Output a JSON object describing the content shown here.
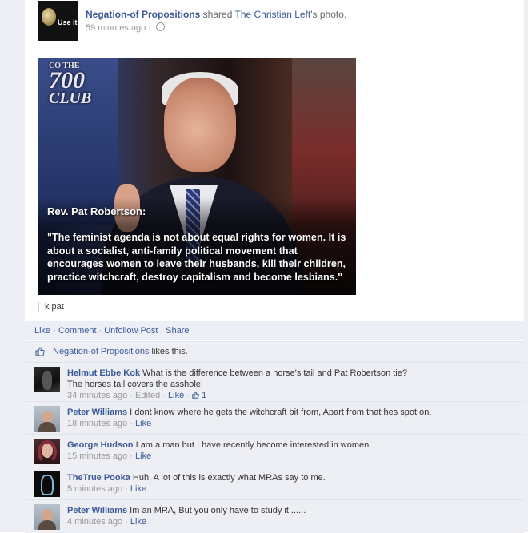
{
  "post": {
    "author": "Negation-of Propositions",
    "shared_text": "shared",
    "source_page": "The Christian Left",
    "source_suffix": "'s photo.",
    "timestamp": "59 minutes ago",
    "dot": "·",
    "avatar_text": "Use it",
    "photo": {
      "logo_line1": "CO THE",
      "logo_line2": "700",
      "logo_line3": "CLUB",
      "caption_name": "Rev. Pat Robertson:",
      "caption_quote": "\"The feminist agenda is not about equal rights for women. It is about a socialist, anti-family political movement that encourages women to leave their husbands, kill their children, practice witchcraft, destroy capitalism and become lesbians.\""
    },
    "photo_caption": "k pat",
    "actions": [
      "Like",
      "Comment",
      "Unfollow Post",
      "Share"
    ],
    "likes": {
      "name": "Negation-of Propositions",
      "suffix": "likes this."
    }
  },
  "comments": [
    {
      "author": "Helmut Ebbe Kok",
      "text": "What is the difference between a horse's tail and Pat Robertson tie?",
      "text2": "The horses tail covers the asshole!",
      "time": "34 minutes ago",
      "edited": "Edited",
      "like": "Like",
      "like_count": "1",
      "avatar": "dark"
    },
    {
      "author": "Peter Williams",
      "text": "I dont know where he gets the witchcraft bit from, Apart from that hes spot on.",
      "time": "18 minutes ago",
      "like": "Like",
      "avatar": "person"
    },
    {
      "author": "George Hudson",
      "text": "I am a man but I have recently become interested in women.",
      "time": "15 minutes ago",
      "like": "Like",
      "avatar": "girl"
    },
    {
      "author": "TheTrue Pooka",
      "text": "Huh. A lot of this is exactly what MRAs say to me.",
      "time": "5 minutes ago",
      "like": "Like",
      "avatar": "pooka"
    },
    {
      "author": "Peter Williams",
      "text": "Im an MRA, But you only have to study it ......",
      "time": "4 minutes ago",
      "like": "Like",
      "avatar": "person"
    }
  ],
  "colors": {
    "link": "#3b5998",
    "ufi_bg": "#edeff4",
    "muted": "#999999"
  },
  "icons": {
    "audience": "globe-icon",
    "like": "thumbs-up-icon"
  }
}
